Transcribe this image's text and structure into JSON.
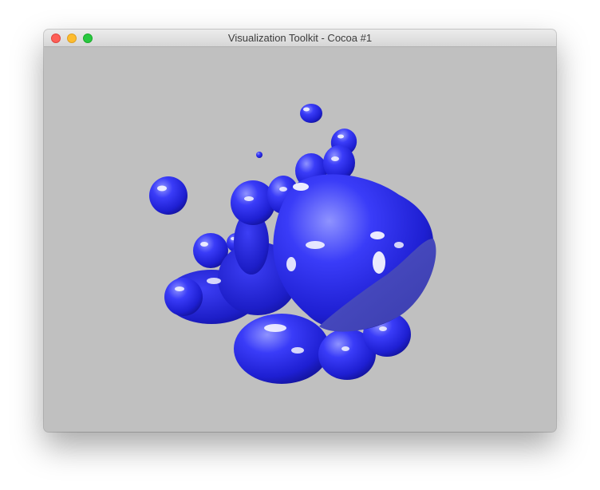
{
  "window": {
    "title": "Visualization Toolkit - Cocoa #1",
    "controls": [
      "close",
      "minimize",
      "zoom"
    ]
  },
  "viewport": {
    "background_color": "#c0c0c0",
    "object": "blue isosurface blobs",
    "object_color": "#2a2cf0"
  }
}
